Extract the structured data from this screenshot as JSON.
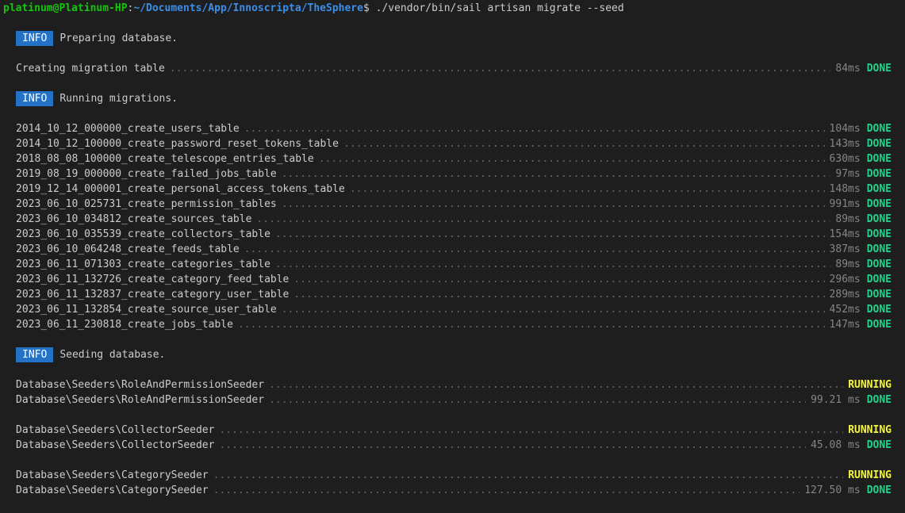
{
  "prompt": {
    "user_host": "platinum@Platinum-HP",
    "separator": ":",
    "path": "~/Documents/App/Innoscripta/TheSphere",
    "symbol": "$",
    "command": " ./vendor/bin/sail artisan migrate --seed"
  },
  "badge_label": "INFO",
  "info": {
    "preparing": "Preparing database.",
    "running": "Running migrations.",
    "seeding": "Seeding database."
  },
  "creating": {
    "label": "Creating migration table",
    "time": "84ms",
    "status": "DONE"
  },
  "migrations": [
    {
      "name": "2014_10_12_000000_create_users_table",
      "time": "104ms",
      "status": "DONE"
    },
    {
      "name": "2014_10_12_100000_create_password_reset_tokens_table",
      "time": "143ms",
      "status": "DONE"
    },
    {
      "name": "2018_08_08_100000_create_telescope_entries_table",
      "time": "630ms",
      "status": "DONE"
    },
    {
      "name": "2019_08_19_000000_create_failed_jobs_table",
      "time": "97ms",
      "status": "DONE"
    },
    {
      "name": "2019_12_14_000001_create_personal_access_tokens_table",
      "time": "148ms",
      "status": "DONE"
    },
    {
      "name": "2023_06_10_025731_create_permission_tables",
      "time": "991ms",
      "status": "DONE"
    },
    {
      "name": "2023_06_10_034812_create_sources_table",
      "time": "89ms",
      "status": "DONE"
    },
    {
      "name": "2023_06_10_035539_create_collectors_table",
      "time": "154ms",
      "status": "DONE"
    },
    {
      "name": "2023_06_10_064248_create_feeds_table",
      "time": "387ms",
      "status": "DONE"
    },
    {
      "name": "2023_06_11_071303_create_categories_table",
      "time": "89ms",
      "status": "DONE"
    },
    {
      "name": "2023_06_11_132726_create_category_feed_table",
      "time": "296ms",
      "status": "DONE"
    },
    {
      "name": "2023_06_11_132837_create_category_user_table",
      "time": "289ms",
      "status": "DONE"
    },
    {
      "name": "2023_06_11_132854_create_source_user_table",
      "time": "452ms",
      "status": "DONE"
    },
    {
      "name": "2023_06_11_230818_create_jobs_table",
      "time": "147ms",
      "status": "DONE"
    }
  ],
  "seeders": [
    {
      "name": "Database\\Seeders\\RoleAndPermissionSeeder",
      "running_status": "RUNNING",
      "time": "99.21 ms",
      "status": "DONE"
    },
    {
      "name": "Database\\Seeders\\CollectorSeeder",
      "running_status": "RUNNING",
      "time": "45.08 ms",
      "status": "DONE"
    },
    {
      "name": "Database\\Seeders\\CategorySeeder",
      "running_status": "RUNNING",
      "time": "127.50 ms",
      "status": "DONE"
    }
  ],
  "colors": {
    "background": "#1e1e1e",
    "user_host": "#16c60c",
    "path": "#3b8eea",
    "badge": "#2472c8",
    "done": "#23d18b",
    "running": "#f5f543"
  }
}
